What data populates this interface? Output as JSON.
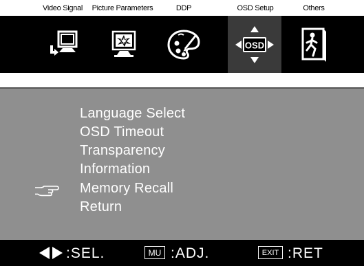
{
  "tabs": [
    {
      "label": "Video Signal",
      "icon": "video-signal-icon"
    },
    {
      "label": "Picture Parameters",
      "icon": "picture-parameters-icon"
    },
    {
      "label": "DDP",
      "icon": "palette-icon"
    },
    {
      "label": "OSD Setup",
      "icon": "osd-setup-icon",
      "active": true
    },
    {
      "label": "Others",
      "icon": "exit-door-icon"
    }
  ],
  "osd_icon_text": "OSD",
  "menu": {
    "items": [
      {
        "label": "Language Select"
      },
      {
        "label": "OSD Timeout"
      },
      {
        "label": "Transparency"
      },
      {
        "label": "Information"
      },
      {
        "label": "Memory Recall",
        "selected": true
      },
      {
        "label": "Return"
      }
    ]
  },
  "footer": {
    "sel_text": ":SEL.",
    "mu_key": "MU",
    "adj_text": ":ADJ.",
    "exit_key": "EXIT",
    "ret_text": ":RET"
  },
  "colors": {
    "bar": "#000000",
    "panel": "#8f8f8f",
    "active_tab": "#3a3a3a",
    "text": "#ffffff"
  }
}
